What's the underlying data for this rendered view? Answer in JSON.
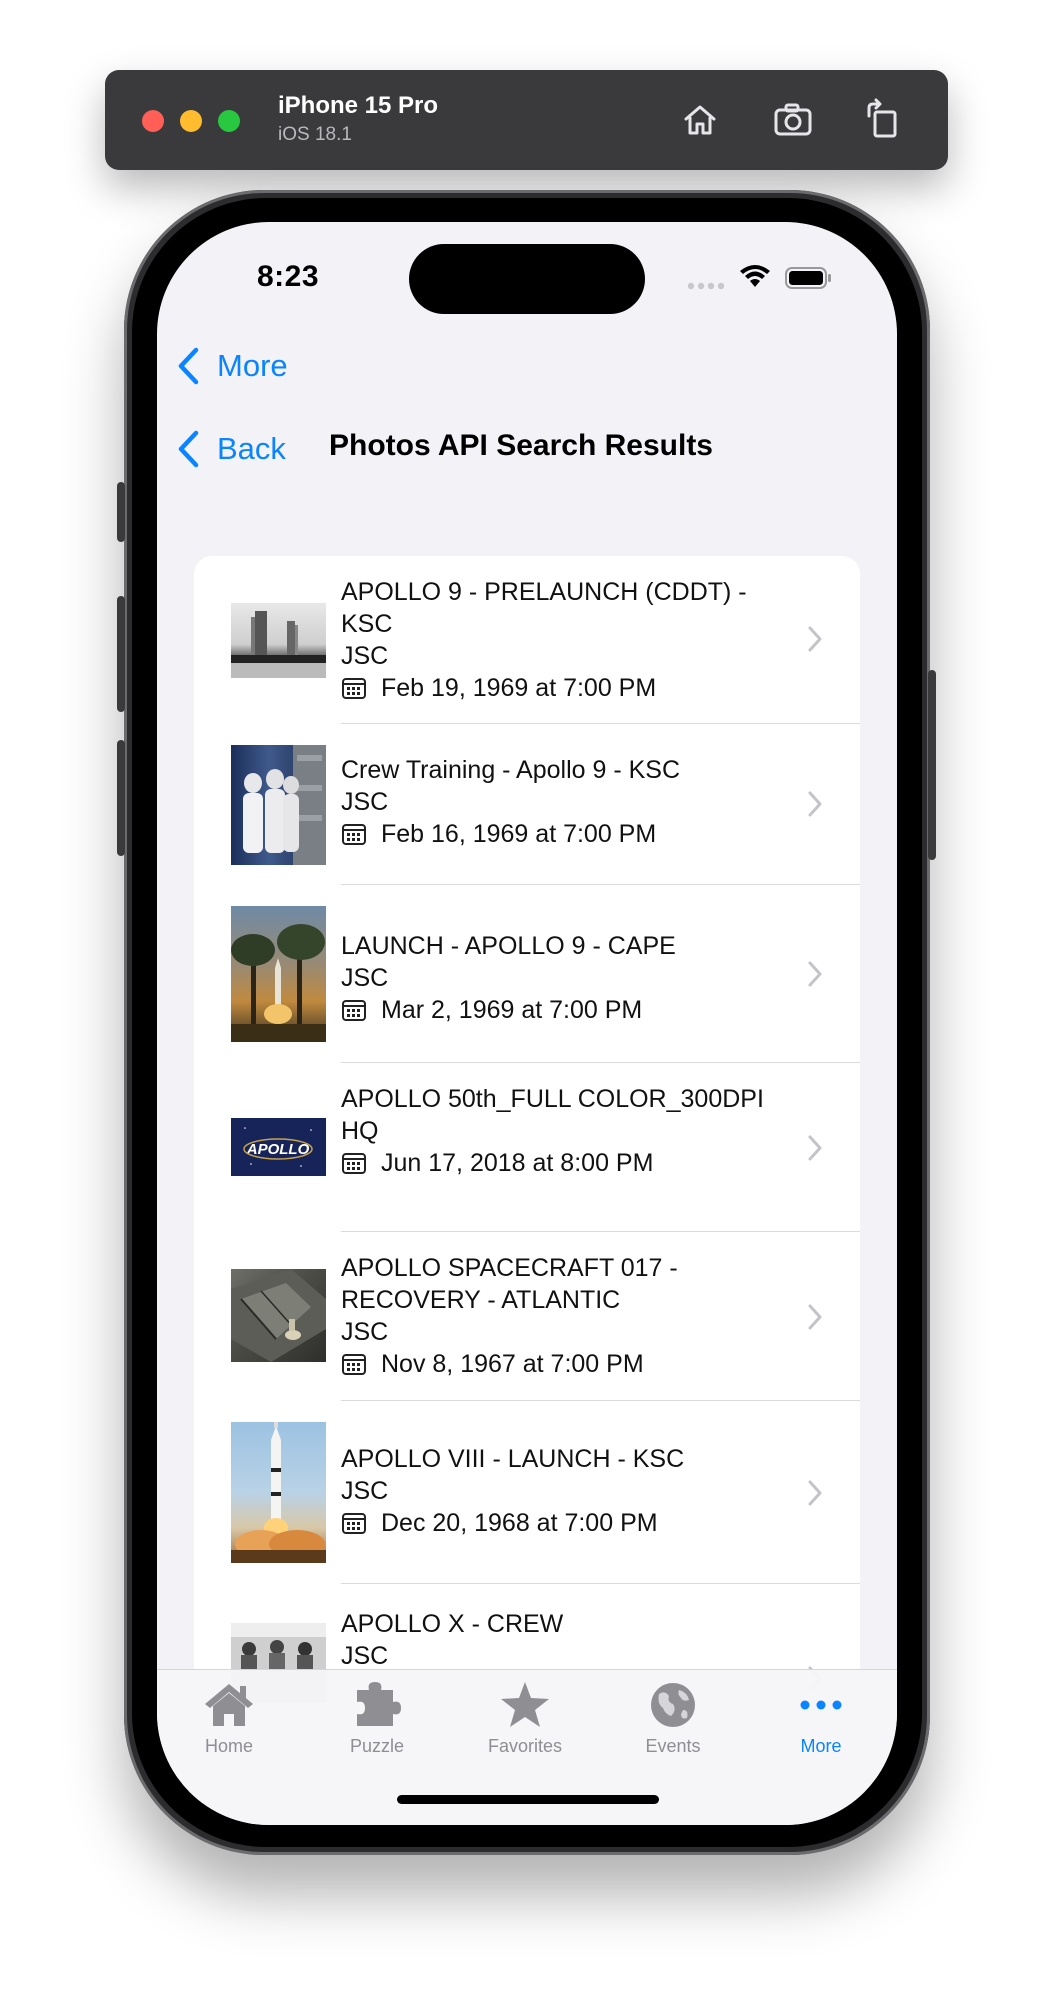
{
  "simulator": {
    "device_name": "iPhone 15 Pro",
    "os_version": "iOS 18.1",
    "toolbar_icons": [
      "home-icon",
      "screenshot-icon",
      "rotate-icon"
    ]
  },
  "status_bar": {
    "time": "8:23"
  },
  "nav": {
    "more_label": "More",
    "back_label": "Back",
    "title": "Photos API Search Results"
  },
  "results": [
    {
      "title": " APOLLO 9 - PRELAUNCH (CDDT) - KSC",
      "center": "JSC",
      "date": "Feb 19, 1969 at 7:00 PM"
    },
    {
      "title": " Crew Training - Apollo 9 - KSC",
      "center": "JSC",
      "date": "Feb 16, 1969 at 7:00 PM"
    },
    {
      "title": " LAUNCH - APOLLO 9 - CAPE",
      "center": "JSC",
      "date": "Mar 2, 1969 at 7:00 PM"
    },
    {
      "title": "APOLLO 50th_FULL COLOR_300DPI",
      "center": "HQ",
      "date": "Jun 17, 2018 at 8:00 PM"
    },
    {
      "title": "APOLLO SPACECRAFT 017 - RECOVERY - ATLANTIC",
      "center": "JSC",
      "date": "Nov 8, 1967 at 7:00 PM"
    },
    {
      "title": "APOLLO VIII - LAUNCH - KSC",
      "center": "JSC",
      "date": "Dec 20, 1968 at 7:00 PM"
    },
    {
      "title": "APOLLO X - CREW",
      "center": "JSC",
      "date": ""
    }
  ],
  "thumbnail_text": {
    "apollo_50_logo": "APOLLO"
  },
  "tabbar": {
    "tabs": [
      {
        "label": "Home",
        "icon": "house-icon"
      },
      {
        "label": "Puzzle",
        "icon": "puzzle-icon"
      },
      {
        "label": "Favorites",
        "icon": "star-icon"
      },
      {
        "label": "Events",
        "icon": "globe-icon"
      },
      {
        "label": "More",
        "icon": "ellipsis-icon"
      }
    ],
    "active": "More"
  },
  "colors": {
    "accent": "#0a84ff",
    "background": "#f2f2f7",
    "inactive_tab": "#8e8e93"
  }
}
